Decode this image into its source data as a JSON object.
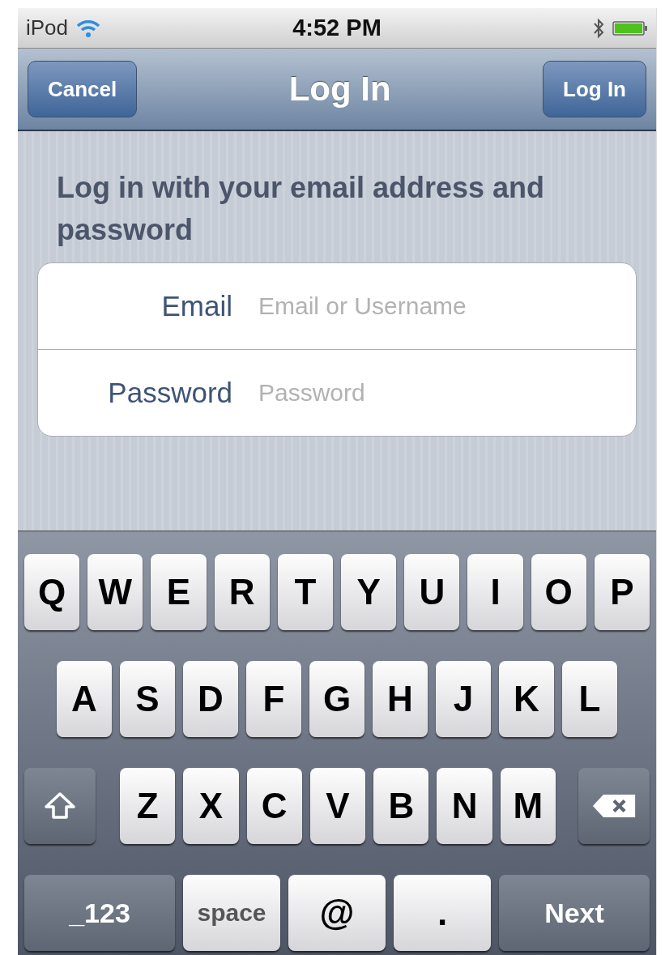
{
  "status_bar": {
    "carrier": "iPod",
    "time": "4:52 PM"
  },
  "nav_bar": {
    "title": "Log In",
    "left_button": "Cancel",
    "right_button": "Log In"
  },
  "form": {
    "heading": "Log in with your email address and password",
    "fields": [
      {
        "label": "Email",
        "placeholder": "Email or Username"
      },
      {
        "label": "Password",
        "placeholder": "Password"
      }
    ]
  },
  "keyboard": {
    "letter_rows": [
      [
        {
          "kind": "char",
          "label": "Q"
        },
        {
          "kind": "char",
          "label": "W"
        },
        {
          "kind": "char",
          "label": "E"
        },
        {
          "kind": "char",
          "label": "R"
        },
        {
          "kind": "char",
          "label": "T"
        },
        {
          "kind": "char",
          "label": "Y"
        },
        {
          "kind": "char",
          "label": "U"
        },
        {
          "kind": "char",
          "label": "I"
        },
        {
          "kind": "char",
          "label": "O"
        },
        {
          "kind": "char",
          "label": "P"
        }
      ],
      [
        {
          "kind": "char",
          "label": "A"
        },
        {
          "kind": "char",
          "label": "S"
        },
        {
          "kind": "char",
          "label": "D"
        },
        {
          "kind": "char",
          "label": "F"
        },
        {
          "kind": "char",
          "label": "G"
        },
        {
          "kind": "char",
          "label": "H"
        },
        {
          "kind": "char",
          "label": "J"
        },
        {
          "kind": "char",
          "label": "K"
        },
        {
          "kind": "char",
          "label": "L"
        }
      ],
      [
        {
          "kind": "shift"
        },
        {
          "kind": "char",
          "label": "Z"
        },
        {
          "kind": "char",
          "label": "X"
        },
        {
          "kind": "char",
          "label": "C"
        },
        {
          "kind": "char",
          "label": "V"
        },
        {
          "kind": "char",
          "label": "B"
        },
        {
          "kind": "char",
          "label": "N"
        },
        {
          "kind": "char",
          "label": "M"
        },
        {
          "kind": "delete"
        }
      ]
    ],
    "bottom_row": {
      "mode_key": "_123",
      "space_key": "space",
      "symbol_keys": [
        "@",
        "."
      ],
      "return_key": "Next"
    }
  }
}
